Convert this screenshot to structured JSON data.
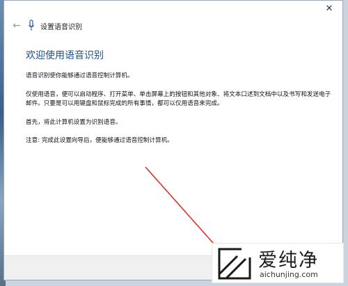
{
  "window": {
    "title": "设置语音识别",
    "close_glyph": "✕",
    "back_glyph": "←"
  },
  "content": {
    "heading": "欢迎使用语音识别",
    "paragraphs": [
      "语音识别使你能够通过语音控制计算机。",
      "仅使用语音，便可以启动程序、打开菜单、单击屏幕上的按钮和其他对象、将文本口述到文档中以及书写和发送电子邮件。只要是可以用键盘和鼠标完成的所有事情，都可以仅用语音来完成。",
      "首先，将此计算机设置为识别语音。",
      "注意: 完成此设置向导后，便能够通过语音控制计算机。"
    ]
  },
  "watermark": {
    "name": "爱纯净",
    "url": "aichunjing.com"
  },
  "colors": {
    "heading": "#1f4e8c",
    "arrow": "#d9302c",
    "logo": "#1a1a1a"
  }
}
